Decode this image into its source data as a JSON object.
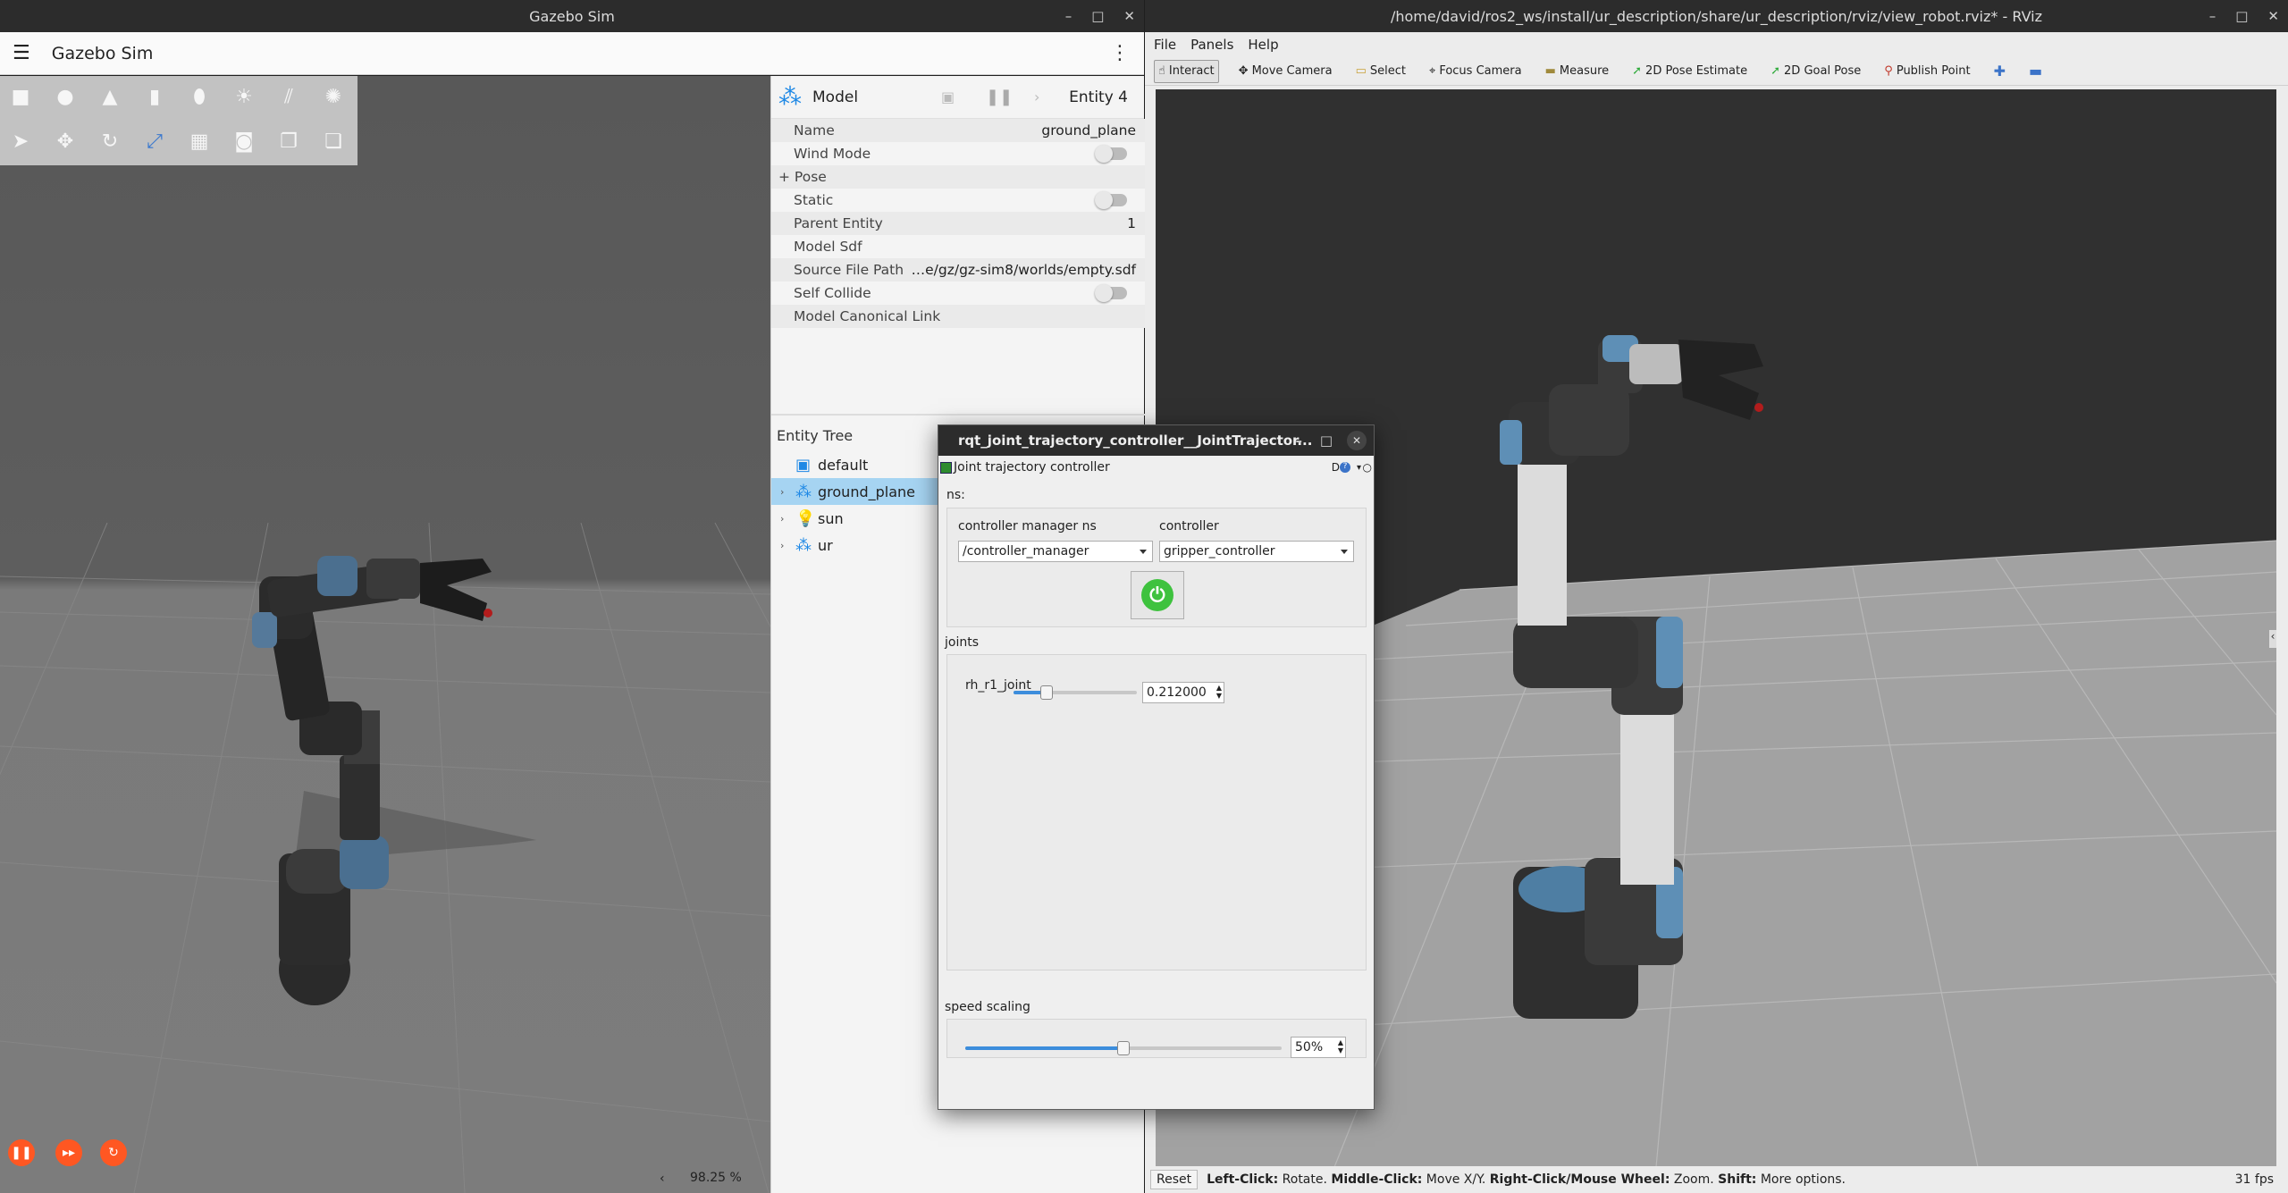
{
  "gazebo": {
    "window_title": "Gazebo Sim",
    "app_title": "Gazebo Sim",
    "component": {
      "header_label": "Model",
      "entity_label": "Entity 4",
      "rows": [
        {
          "key": "Name",
          "value": "ground_plane"
        },
        {
          "key": "Wind Mode",
          "toggle": true
        },
        {
          "key": "+ Pose",
          "value": ""
        },
        {
          "key": "Static",
          "toggle": true
        },
        {
          "key": "Parent Entity",
          "value": "1"
        },
        {
          "key": "Model Sdf",
          "value": ""
        },
        {
          "key": "Source File Path",
          "value": "…e/gz/gz-sim8/worlds/empty.sdf"
        },
        {
          "key": "Self Collide",
          "toggle": true
        },
        {
          "key": "Model Canonical Link",
          "value": ""
        }
      ]
    },
    "entity_tree": {
      "title": "Entity Tree",
      "items": [
        {
          "label": "default",
          "icon": "world-icon",
          "selected": false,
          "expandable": false
        },
        {
          "label": "ground_plane",
          "icon": "model-icon",
          "selected": true,
          "expandable": true
        },
        {
          "label": "sun",
          "icon": "light-icon",
          "selected": false,
          "expandable": true
        },
        {
          "label": "ur",
          "icon": "model-icon",
          "selected": false,
          "expandable": true
        }
      ]
    },
    "rtf": "98.25 %",
    "colors": {
      "accent": "#ff5722",
      "selected": "#a6d4f2"
    }
  },
  "rviz": {
    "window_title": "/home/david/ros2_ws/install/ur_description/share/ur_description/rviz/view_robot.rviz* - RViz",
    "menu": [
      "File",
      "Panels",
      "Help"
    ],
    "tools": [
      "Interact",
      "Move Camera",
      "Select",
      "Focus Camera",
      "Measure",
      "2D Pose Estimate",
      "2D Goal Pose",
      "Publish Point"
    ],
    "status": {
      "reset": "Reset",
      "left_click": "Left-Click:",
      "left_desc": " Rotate. ",
      "middle_click": "Middle-Click:",
      "middle_desc": " Move X/Y. ",
      "right_click": "Right-Click/Mouse Wheel:",
      "right_desc": " Zoom. ",
      "shift": "Shift:",
      "shift_desc": " More options.",
      "fps": "31 fps"
    }
  },
  "rqt": {
    "window_title": "rqt_joint_trajectory_controller__JointTrajector...",
    "plugin_title": "Joint trajectory controller",
    "plugin_buttons": "D",
    "ns_label": "ns:",
    "cm_label": "controller manager ns",
    "cm_value": "/controller_manager",
    "controller_label": "controller",
    "controller_value": "gripper_controller",
    "joints_label": "joints",
    "joint": {
      "name": "rh_r1_joint",
      "value": "0.212000",
      "fraction": 0.27
    },
    "speed_label": "speed scaling",
    "speed_value": "50%",
    "speed_fraction": 0.5
  }
}
